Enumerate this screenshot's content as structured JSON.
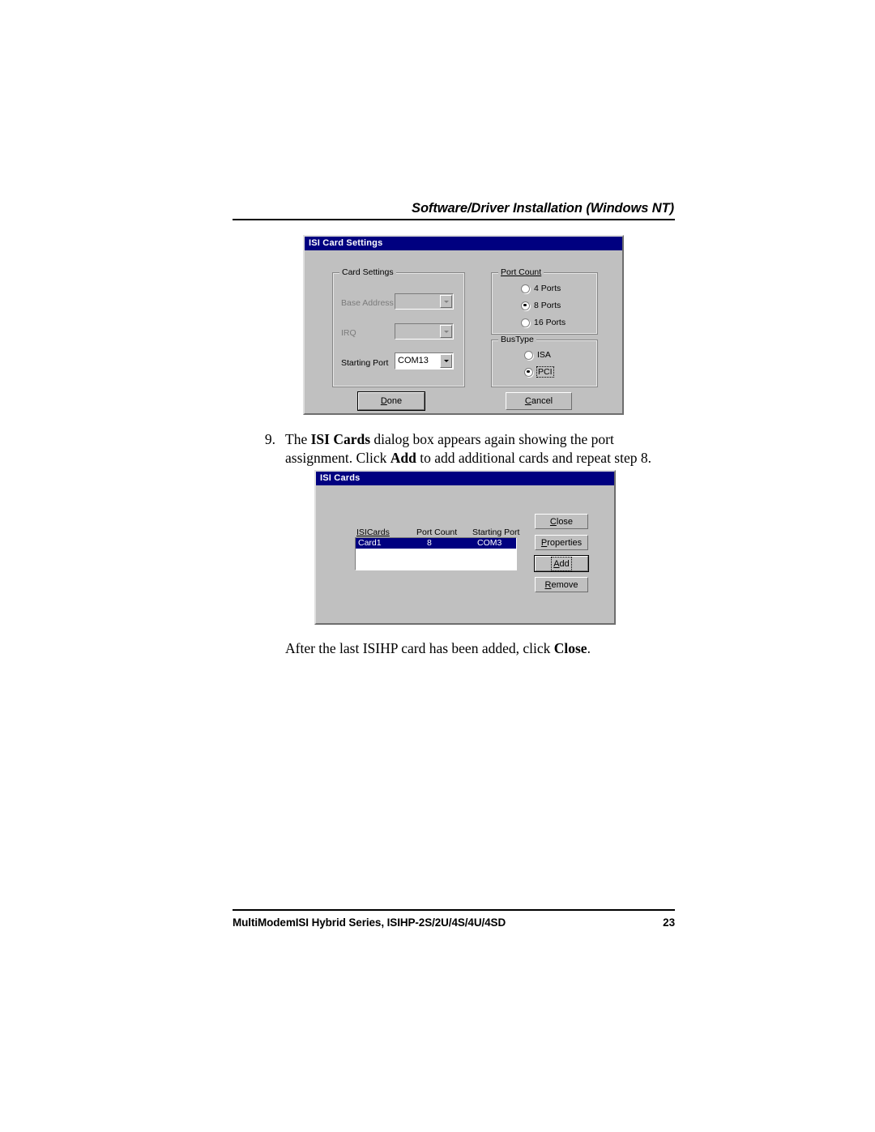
{
  "header": {
    "title": "Software/Driver Installation (Windows NT)"
  },
  "dialog_card_settings": {
    "title": "ISI Card Settings",
    "card_settings_group": {
      "legend": "Card Settings",
      "fields": [
        {
          "label": "Base Address",
          "value": "",
          "enabled": false
        },
        {
          "label": "IRQ",
          "value": "",
          "enabled": false
        },
        {
          "label": "Starting Port",
          "value": "COM13",
          "enabled": true
        }
      ]
    },
    "port_count_group": {
      "legend": "Port Count",
      "options": [
        {
          "label": "4 Ports",
          "selected": false
        },
        {
          "label": "8 Ports",
          "selected": true
        },
        {
          "label": "16 Ports",
          "selected": false
        }
      ]
    },
    "bus_type_group": {
      "legend": "BusType",
      "options": [
        {
          "label": "ISA",
          "selected": false
        },
        {
          "label": "PCI",
          "selected": true
        }
      ]
    },
    "buttons": {
      "done": "Done",
      "cancel": "Cancel"
    }
  },
  "step9": {
    "number": "9.",
    "line1_a": "The ",
    "line1_b": "ISI Cards",
    "line1_c": " dialog box appears again showing the port",
    "line2_a": "assignment. Click ",
    "line2_b": "Add",
    "line2_c": " to add additional cards and repeat step 8."
  },
  "dialog_isi_cards": {
    "title": "ISI Cards",
    "columns": [
      "ISICards",
      "Port Count",
      "Starting Port"
    ],
    "rows": [
      {
        "name": "Card1",
        "port_count": "8",
        "starting_port": "COM3",
        "selected": true
      }
    ],
    "buttons": {
      "close": "Close",
      "properties": "Properties",
      "add": "Add",
      "remove": "Remove"
    }
  },
  "caption": {
    "text_a": "After the last ISIHP card has been added, click ",
    "text_b": "Close",
    "text_c": "."
  },
  "footer": {
    "title": "MultiModemISI Hybrid Series, ISIHP-2S/2U/4S/4U/4SD",
    "page_number": "23"
  },
  "colors": {
    "titlebar": "#000080",
    "dialog_face": "#c0c0c0",
    "selection": "#000080"
  }
}
